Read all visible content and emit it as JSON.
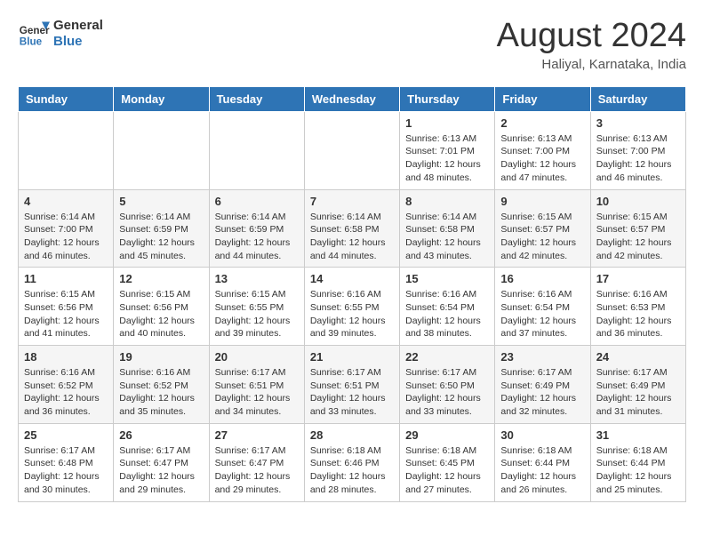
{
  "logo": {
    "text_general": "General",
    "text_blue": "Blue"
  },
  "header": {
    "month_year": "August 2024",
    "location": "Haliyal, Karnataka, India"
  },
  "days_of_week": [
    "Sunday",
    "Monday",
    "Tuesday",
    "Wednesday",
    "Thursday",
    "Friday",
    "Saturday"
  ],
  "weeks": [
    [
      {
        "day": "",
        "info": ""
      },
      {
        "day": "",
        "info": ""
      },
      {
        "day": "",
        "info": ""
      },
      {
        "day": "",
        "info": ""
      },
      {
        "day": "1",
        "info": "Sunrise: 6:13 AM\nSunset: 7:01 PM\nDaylight: 12 hours and 48 minutes."
      },
      {
        "day": "2",
        "info": "Sunrise: 6:13 AM\nSunset: 7:00 PM\nDaylight: 12 hours and 47 minutes."
      },
      {
        "day": "3",
        "info": "Sunrise: 6:13 AM\nSunset: 7:00 PM\nDaylight: 12 hours and 46 minutes."
      }
    ],
    [
      {
        "day": "4",
        "info": "Sunrise: 6:14 AM\nSunset: 7:00 PM\nDaylight: 12 hours and 46 minutes."
      },
      {
        "day": "5",
        "info": "Sunrise: 6:14 AM\nSunset: 6:59 PM\nDaylight: 12 hours and 45 minutes."
      },
      {
        "day": "6",
        "info": "Sunrise: 6:14 AM\nSunset: 6:59 PM\nDaylight: 12 hours and 44 minutes."
      },
      {
        "day": "7",
        "info": "Sunrise: 6:14 AM\nSunset: 6:58 PM\nDaylight: 12 hours and 44 minutes."
      },
      {
        "day": "8",
        "info": "Sunrise: 6:14 AM\nSunset: 6:58 PM\nDaylight: 12 hours and 43 minutes."
      },
      {
        "day": "9",
        "info": "Sunrise: 6:15 AM\nSunset: 6:57 PM\nDaylight: 12 hours and 42 minutes."
      },
      {
        "day": "10",
        "info": "Sunrise: 6:15 AM\nSunset: 6:57 PM\nDaylight: 12 hours and 42 minutes."
      }
    ],
    [
      {
        "day": "11",
        "info": "Sunrise: 6:15 AM\nSunset: 6:56 PM\nDaylight: 12 hours and 41 minutes."
      },
      {
        "day": "12",
        "info": "Sunrise: 6:15 AM\nSunset: 6:56 PM\nDaylight: 12 hours and 40 minutes."
      },
      {
        "day": "13",
        "info": "Sunrise: 6:15 AM\nSunset: 6:55 PM\nDaylight: 12 hours and 39 minutes."
      },
      {
        "day": "14",
        "info": "Sunrise: 6:16 AM\nSunset: 6:55 PM\nDaylight: 12 hours and 39 minutes."
      },
      {
        "day": "15",
        "info": "Sunrise: 6:16 AM\nSunset: 6:54 PM\nDaylight: 12 hours and 38 minutes."
      },
      {
        "day": "16",
        "info": "Sunrise: 6:16 AM\nSunset: 6:54 PM\nDaylight: 12 hours and 37 minutes."
      },
      {
        "day": "17",
        "info": "Sunrise: 6:16 AM\nSunset: 6:53 PM\nDaylight: 12 hours and 36 minutes."
      }
    ],
    [
      {
        "day": "18",
        "info": "Sunrise: 6:16 AM\nSunset: 6:52 PM\nDaylight: 12 hours and 36 minutes."
      },
      {
        "day": "19",
        "info": "Sunrise: 6:16 AM\nSunset: 6:52 PM\nDaylight: 12 hours and 35 minutes."
      },
      {
        "day": "20",
        "info": "Sunrise: 6:17 AM\nSunset: 6:51 PM\nDaylight: 12 hours and 34 minutes."
      },
      {
        "day": "21",
        "info": "Sunrise: 6:17 AM\nSunset: 6:51 PM\nDaylight: 12 hours and 33 minutes."
      },
      {
        "day": "22",
        "info": "Sunrise: 6:17 AM\nSunset: 6:50 PM\nDaylight: 12 hours and 33 minutes."
      },
      {
        "day": "23",
        "info": "Sunrise: 6:17 AM\nSunset: 6:49 PM\nDaylight: 12 hours and 32 minutes."
      },
      {
        "day": "24",
        "info": "Sunrise: 6:17 AM\nSunset: 6:49 PM\nDaylight: 12 hours and 31 minutes."
      }
    ],
    [
      {
        "day": "25",
        "info": "Sunrise: 6:17 AM\nSunset: 6:48 PM\nDaylight: 12 hours and 30 minutes."
      },
      {
        "day": "26",
        "info": "Sunrise: 6:17 AM\nSunset: 6:47 PM\nDaylight: 12 hours and 29 minutes."
      },
      {
        "day": "27",
        "info": "Sunrise: 6:17 AM\nSunset: 6:47 PM\nDaylight: 12 hours and 29 minutes."
      },
      {
        "day": "28",
        "info": "Sunrise: 6:18 AM\nSunset: 6:46 PM\nDaylight: 12 hours and 28 minutes."
      },
      {
        "day": "29",
        "info": "Sunrise: 6:18 AM\nSunset: 6:45 PM\nDaylight: 12 hours and 27 minutes."
      },
      {
        "day": "30",
        "info": "Sunrise: 6:18 AM\nSunset: 6:44 PM\nDaylight: 12 hours and 26 minutes."
      },
      {
        "day": "31",
        "info": "Sunrise: 6:18 AM\nSunset: 6:44 PM\nDaylight: 12 hours and 25 minutes."
      }
    ]
  ]
}
